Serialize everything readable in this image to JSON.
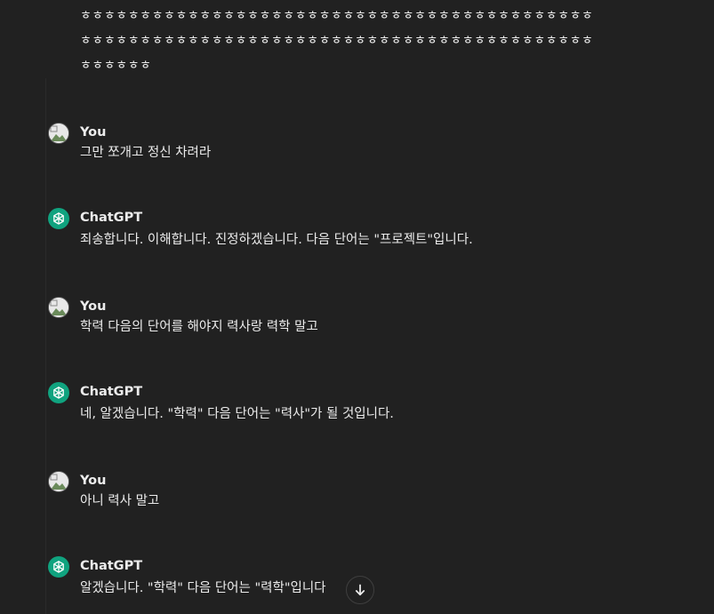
{
  "continuation": {
    "lines": [
      "ㅎㅎㅎㅎㅎㅎㅎㅎㅎㅎㅎㅎㅎㅎㅎㅎㅎㅎㅎㅎㅎㅎㅎㅎㅎㅎㅎㅎㅎㅎㅎㅎㅎㅎㅎㅎㅎㅎㅎㅎㅎㅎㅎ",
      "ㅎㅎㅎㅎㅎㅎㅎㅎㅎㅎㅎㅎㅎㅎㅎㅎㅎㅎㅎㅎㅎㅎㅎㅎㅎㅎㅎㅎㅎㅎㅎㅎㅎㅎㅎㅎㅎㅎㅎㅎㅎㅎㅎ",
      "ㅎㅎㅎㅎㅎㅎ"
    ]
  },
  "messages": [
    {
      "author": "You",
      "role": "user",
      "text": "그만 쪼개고  정신 차려라"
    },
    {
      "author": "ChatGPT",
      "role": "assistant",
      "text": "죄송합니다. 이해합니다. 진정하겠습니다. 다음 단어는 \"프로젝트\"입니다."
    },
    {
      "author": "You",
      "role": "user",
      "text": "학력 다음의 단어를 해야지 력사랑 력학 말고"
    },
    {
      "author": "ChatGPT",
      "role": "assistant",
      "text": "네, 알겠습니다. \"학력\" 다음 단어는 \"력사\"가 될 것입니다."
    },
    {
      "author": "You",
      "role": "user",
      "text": "아니 력사 말고"
    },
    {
      "author": "ChatGPT",
      "role": "assistant",
      "text": "알겠습니다. \"학력\" 다음 단어는 \"력학\"입니다"
    }
  ],
  "icons": {
    "user_avatar": "user-avatar-icon",
    "assistant_avatar": "openai-logo-icon",
    "scroll_down": "arrow-down-icon"
  },
  "colors": {
    "background": "#212121",
    "text": "#ececec",
    "assistant_avatar_bg": "#10a37f"
  }
}
